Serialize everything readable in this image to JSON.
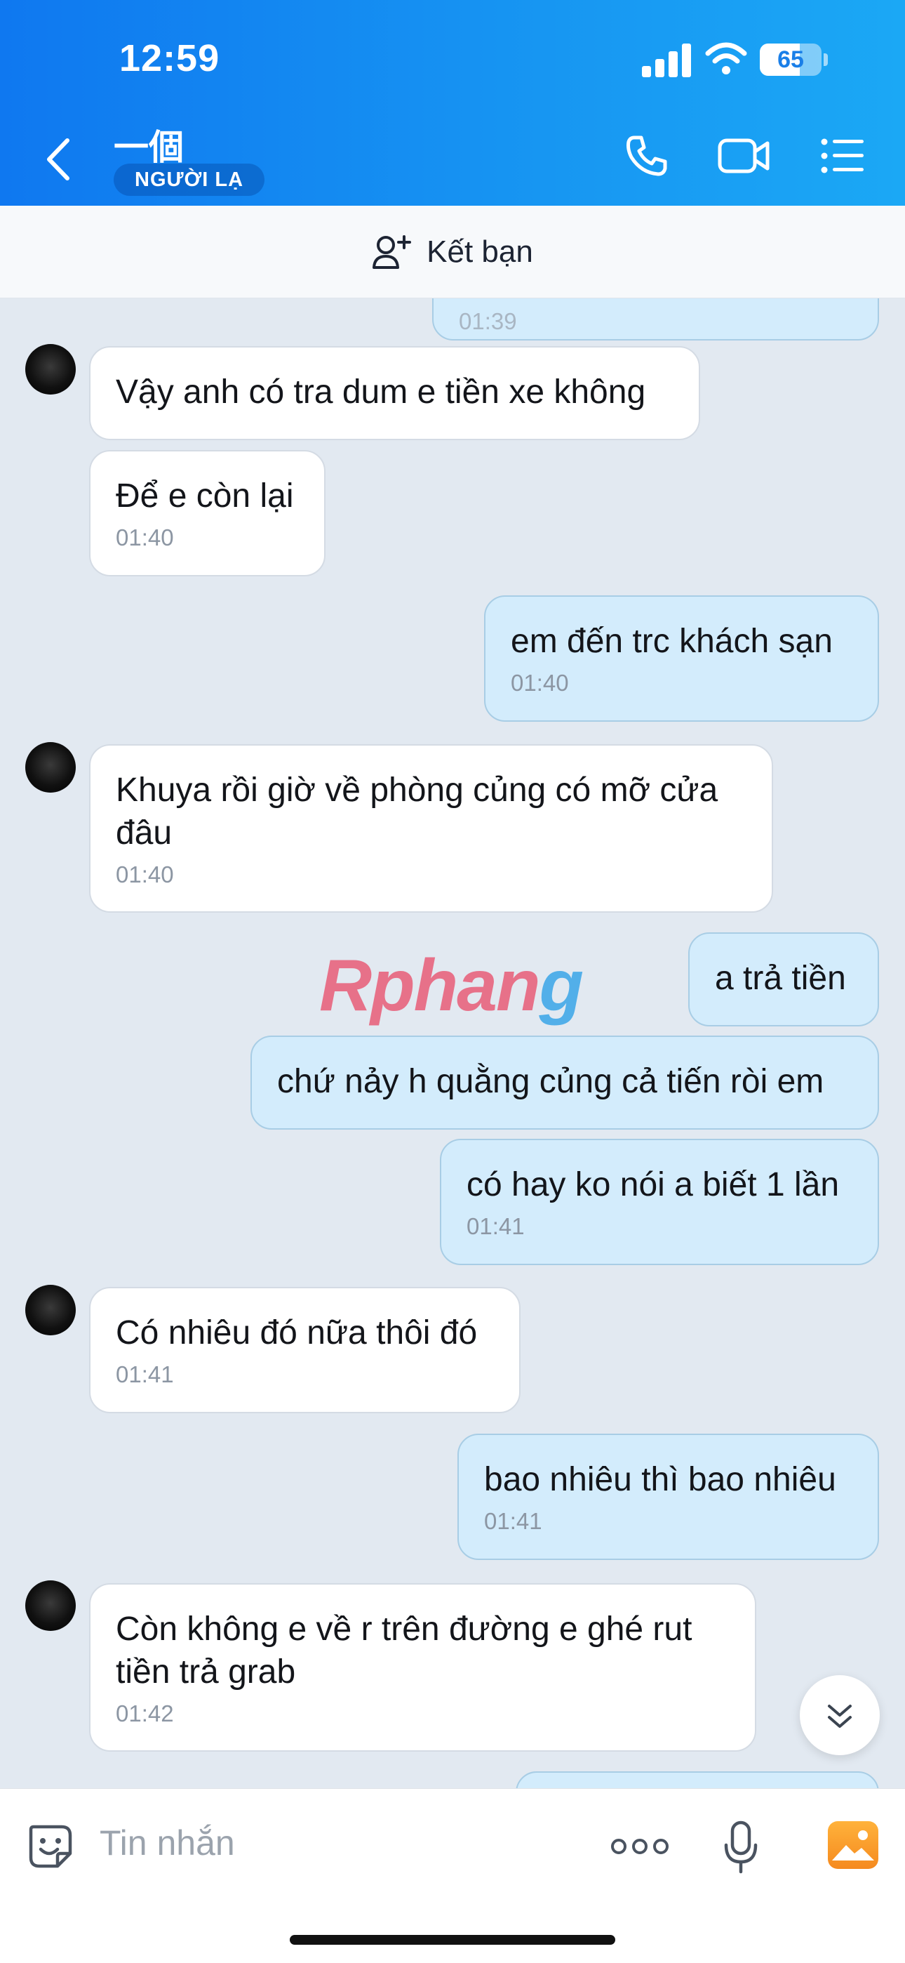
{
  "status_bar": {
    "time": "12:59",
    "battery": "65",
    "battery_level": 0.65
  },
  "header": {
    "title": "一個",
    "badge": "NGƯỜI LẠ"
  },
  "friend_bar": {
    "label": "Kết bạn"
  },
  "messages": [
    {
      "dir": "out",
      "text": "",
      "time": "01:39"
    },
    {
      "dir": "in",
      "text": "Vậy anh có tra dum e tiền xe không",
      "time": ""
    },
    {
      "dir": "in",
      "text": "Để e còn lại",
      "time": "01:40"
    },
    {
      "dir": "out",
      "text": "em đến trc khách sạn",
      "time": "01:40"
    },
    {
      "dir": "in",
      "text": "Khuya rồi giờ về phòng củng có mỡ cửa đâu",
      "time": "01:40"
    },
    {
      "dir": "out",
      "text": "a trả tiền",
      "time": ""
    },
    {
      "dir": "out",
      "text": "chứ nảy h quằng củng cả tiến ròi em",
      "time": ""
    },
    {
      "dir": "out",
      "text": "có hay ko nói a biết 1 lần",
      "time": "01:41"
    },
    {
      "dir": "in",
      "text": "Có nhiêu đó nữa thôi đó",
      "time": "01:41"
    },
    {
      "dir": "out",
      "text": "bao nhiêu thì bao nhiêu",
      "time": "01:41"
    },
    {
      "dir": "in",
      "text": "Còn không e về r trên đường e ghé rut tiền trả grab",
      "time": "01:42"
    }
  ],
  "watermark": {
    "part1": "Rphan",
    "part2": "g"
  },
  "composer": {
    "placeholder": "Tin nhắn"
  },
  "colors": {
    "header_start": "#0f78f0",
    "header_end": "#1ba8f5",
    "bubble_out": "#d3ecfc",
    "bubble_in": "#ffffff",
    "chat_bg": "#e2e9f1"
  },
  "icons": [
    "back-icon",
    "phone-icon",
    "video-call-icon",
    "list-menu-icon",
    "add-friend-icon",
    "sticker-icon",
    "more-icon",
    "microphone-icon",
    "gallery-icon",
    "chevron-down-icon"
  ]
}
